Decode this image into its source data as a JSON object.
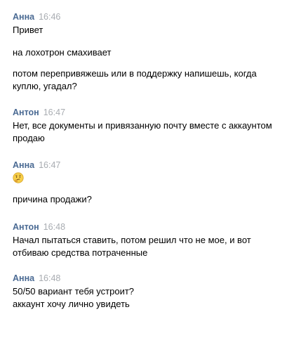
{
  "messages": [
    {
      "author": "Анна",
      "time": "16:46",
      "lines": [
        "Привет",
        "на лохотрон смахивает",
        "потом перепривяжешь или в поддержку напишешь, когда\nкуплю, угадал?"
      ]
    },
    {
      "author": "Антон",
      "time": "16:47",
      "lines": [
        "Нет, все документы и привязанную почту вместе с аккаунтом\nпродаю"
      ]
    },
    {
      "author": "Анна",
      "time": "16:47",
      "emoji": "thinking-face-icon",
      "lines": [
        "причина продажи?"
      ]
    },
    {
      "author": "Антон",
      "time": "16:48",
      "lines": [
        "Начал пытаться ставить, потом решил что не мое, и вот\nотбиваю средства потраченные"
      ]
    },
    {
      "author": "Анна",
      "time": "16:48",
      "lines": [
        "50/50 вариант тебя устроит?\nаккаунт хочу лично увидеть"
      ]
    }
  ],
  "colors": {
    "author": "#4a6a93",
    "time": "#a8acb1",
    "text": "#000000",
    "background": "#ffffff"
  }
}
